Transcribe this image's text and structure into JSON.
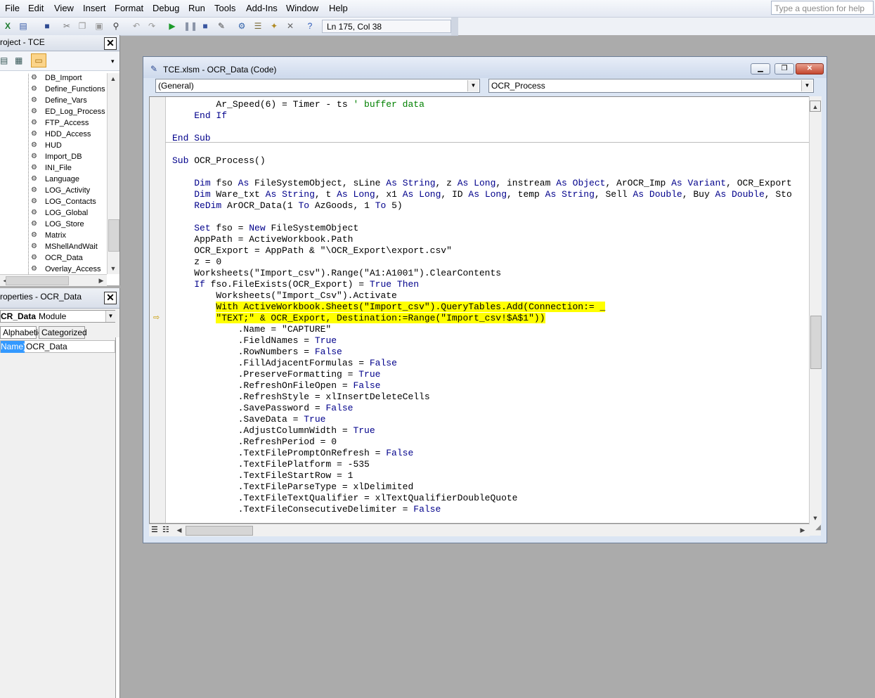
{
  "menu": [
    "File",
    "Edit",
    "View",
    "Insert",
    "Format",
    "Debug",
    "Run",
    "Tools",
    "Add-Ins",
    "Window",
    "Help"
  ],
  "ask_placeholder": "Type a question for help",
  "toolbar": {
    "cursor_position": "Ln 175, Col 38",
    "icons": [
      "excel-icon",
      "insert-userform-icon",
      "save-icon",
      "cut-icon",
      "copy-icon",
      "paste-icon",
      "find-icon",
      "undo-icon",
      "redo-icon",
      "run-icon",
      "break-icon",
      "reset-icon",
      "design-mode-icon",
      "project-explorer-icon",
      "properties-icon",
      "object-browser-icon",
      "toolbox-icon",
      "help-icon"
    ]
  },
  "project": {
    "title": "roject - TCE",
    "items": [
      "DB_Import",
      "Define_Functions",
      "Define_Vars",
      "ED_Log_Process",
      "FTP_Access",
      "HDD_Access",
      "HUD",
      "Import_DB",
      "INI_File",
      "Language",
      "LOG_Activity",
      "LOG_Contacts",
      "LOG_Global",
      "LOG_Store",
      "Matrix",
      "MShellAndWait",
      "OCR_Data",
      "Overlay_Access"
    ]
  },
  "properties": {
    "title": "roperties - OCR_Data",
    "object_name": "CR_Data",
    "object_type": "Module",
    "tabs": [
      "Alphabetic",
      "Categorized"
    ],
    "row_name": "Name)",
    "row_value": "OCR_Data"
  },
  "codewindow": {
    "title": "TCE.xlsm - OCR_Data (Code)",
    "object_combo": "(General)",
    "procedure_combo": "OCR_Process",
    "lines": [
      [
        [
          "        Ar_Speed(6) = Timer - ts ",
          ""
        ],
        [
          "' buffer data",
          "cm"
        ]
      ],
      [
        [
          "    ",
          ""
        ],
        [
          "End If",
          "kw"
        ]
      ],
      [
        [
          "",
          ""
        ]
      ],
      [
        [
          "End Sub",
          "kw"
        ]
      ],
      [
        [
          "",
          ""
        ]
      ],
      [
        [
          "Sub",
          "kw"
        ],
        [
          " OCR_Process()",
          ""
        ]
      ],
      [
        [
          "",
          ""
        ]
      ],
      [
        [
          "    ",
          ""
        ],
        [
          "Dim",
          "kw"
        ],
        [
          " fso ",
          ""
        ],
        [
          "As",
          "kw"
        ],
        [
          " FileSystemObject, sLine ",
          ""
        ],
        [
          "As",
          "kw"
        ],
        [
          " ",
          ""
        ],
        [
          "String",
          "kw"
        ],
        [
          ", z ",
          ""
        ],
        [
          "As",
          "kw"
        ],
        [
          " ",
          ""
        ],
        [
          "Long",
          "kw"
        ],
        [
          ", instream ",
          ""
        ],
        [
          "As",
          "kw"
        ],
        [
          " ",
          ""
        ],
        [
          "Object",
          "kw"
        ],
        [
          ", ArOCR_Imp ",
          ""
        ],
        [
          "As",
          "kw"
        ],
        [
          " ",
          ""
        ],
        [
          "Variant",
          "kw"
        ],
        [
          ", OCR_Export",
          ""
        ]
      ],
      [
        [
          "    ",
          ""
        ],
        [
          "Dim",
          "kw"
        ],
        [
          " Ware_txt ",
          ""
        ],
        [
          "As",
          "kw"
        ],
        [
          " ",
          ""
        ],
        [
          "String",
          "kw"
        ],
        [
          ", t ",
          ""
        ],
        [
          "As",
          "kw"
        ],
        [
          " ",
          ""
        ],
        [
          "Long",
          "kw"
        ],
        [
          ", x1 ",
          ""
        ],
        [
          "As",
          "kw"
        ],
        [
          " ",
          ""
        ],
        [
          "Long",
          "kw"
        ],
        [
          ", ID ",
          ""
        ],
        [
          "As",
          "kw"
        ],
        [
          " ",
          ""
        ],
        [
          "Long",
          "kw"
        ],
        [
          ", temp ",
          ""
        ],
        [
          "As",
          "kw"
        ],
        [
          " ",
          ""
        ],
        [
          "String",
          "kw"
        ],
        [
          ", Sell ",
          ""
        ],
        [
          "As",
          "kw"
        ],
        [
          " ",
          ""
        ],
        [
          "Double",
          "kw"
        ],
        [
          ", Buy ",
          ""
        ],
        [
          "As",
          "kw"
        ],
        [
          " ",
          ""
        ],
        [
          "Double",
          "kw"
        ],
        [
          ", Sto",
          ""
        ]
      ],
      [
        [
          "    ",
          ""
        ],
        [
          "ReDim",
          "kw"
        ],
        [
          " ArOCR_Data(1 ",
          ""
        ],
        [
          "To",
          "kw"
        ],
        [
          " AzGoods, 1 ",
          ""
        ],
        [
          "To",
          "kw"
        ],
        [
          " 5)",
          ""
        ]
      ],
      [
        [
          "",
          ""
        ]
      ],
      [
        [
          "    ",
          ""
        ],
        [
          "Set",
          "kw"
        ],
        [
          " fso = ",
          ""
        ],
        [
          "New",
          "kw"
        ],
        [
          " FileSystemObject",
          ""
        ]
      ],
      [
        [
          "    AppPath = ActiveWorkbook.Path",
          ""
        ]
      ],
      [
        [
          "    OCR_Export = AppPath & \"\\OCR_Export\\export.csv\"",
          ""
        ]
      ],
      [
        [
          "    z = 0",
          ""
        ]
      ],
      [
        [
          "    Worksheets(\"Import_csv\").Range(\"A1:A1001\").ClearContents",
          ""
        ]
      ],
      [
        [
          "    ",
          ""
        ],
        [
          "If",
          "kw"
        ],
        [
          " fso.FileExists(OCR_Export) = ",
          ""
        ],
        [
          "True",
          "kw"
        ],
        [
          " ",
          ""
        ],
        [
          "Then",
          "kw"
        ]
      ],
      [
        [
          "        Worksheets(\"Import_Csv\").Activate",
          ""
        ]
      ],
      [
        [
          "        ",
          ""
        ],
        [
          "With ActiveWorkbook.Sheets(\"Import_csv\").QueryTables.Add(Connection:= _",
          "hl"
        ]
      ],
      [
        [
          "        ",
          ""
        ],
        [
          "\"TEXT;\" & OCR_Export, Destination:=Range(\"Import_csv!$A$1\"))",
          "hl"
        ]
      ],
      [
        [
          "            .Name = \"CAPTURE\"",
          ""
        ]
      ],
      [
        [
          "            .FieldNames = ",
          ""
        ],
        [
          "True",
          "kw"
        ]
      ],
      [
        [
          "            .RowNumbers = ",
          ""
        ],
        [
          "False",
          "kw"
        ]
      ],
      [
        [
          "            .FillAdjacentFormulas = ",
          ""
        ],
        [
          "False",
          "kw"
        ]
      ],
      [
        [
          "            .PreserveFormatting = ",
          ""
        ],
        [
          "True",
          "kw"
        ]
      ],
      [
        [
          "            .RefreshOnFileOpen = ",
          ""
        ],
        [
          "False",
          "kw"
        ]
      ],
      [
        [
          "            .RefreshStyle = xlInsertDeleteCells",
          ""
        ]
      ],
      [
        [
          "            .SavePassword = ",
          ""
        ],
        [
          "False",
          "kw"
        ]
      ],
      [
        [
          "            .SaveData = ",
          ""
        ],
        [
          "True",
          "kw"
        ]
      ],
      [
        [
          "            .AdjustColumnWidth = ",
          ""
        ],
        [
          "True",
          "kw"
        ]
      ],
      [
        [
          "            .RefreshPeriod = 0",
          ""
        ]
      ],
      [
        [
          "            .TextFilePromptOnRefresh = ",
          ""
        ],
        [
          "False",
          "kw"
        ]
      ],
      [
        [
          "            .TextFilePlatform = -535",
          ""
        ]
      ],
      [
        [
          "            .TextFileStartRow = 1",
          ""
        ]
      ],
      [
        [
          "            .TextFileParseType = xlDelimited",
          ""
        ]
      ],
      [
        [
          "            .TextFileTextQualifier = xlTextQualifierDoubleQuote",
          ""
        ]
      ],
      [
        [
          "            .TextFileConsecutiveDelimiter = ",
          ""
        ],
        [
          "False",
          "kw"
        ]
      ]
    ]
  }
}
